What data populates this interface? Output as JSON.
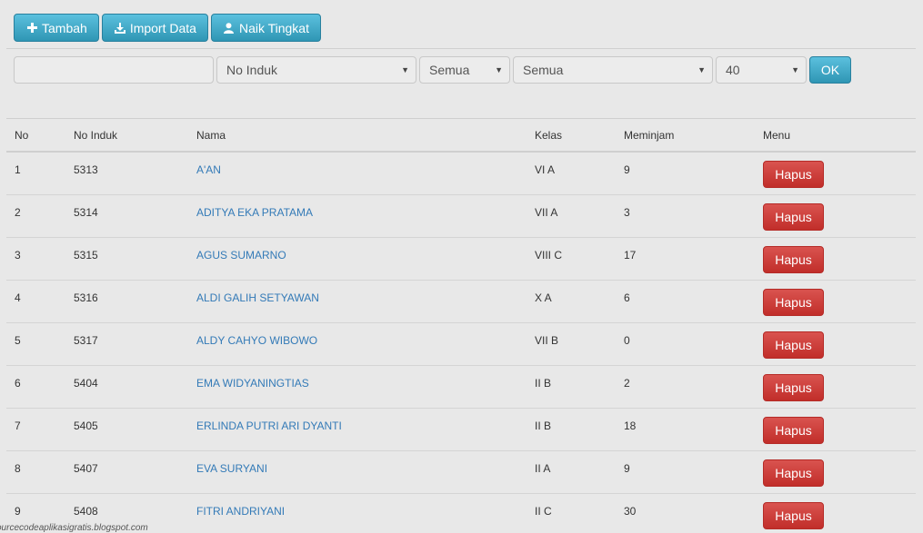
{
  "toolbar": {
    "add_label": "Tambah",
    "import_label": "Import Data",
    "promote_label": "Naik Tingkat"
  },
  "filters": {
    "search_value": "",
    "field_select": "No Induk",
    "kelas_select": "Semua",
    "status_select": "Semua",
    "limit_select": "40",
    "ok_label": "OK"
  },
  "table": {
    "headers": {
      "no": "No",
      "induk": "No Induk",
      "nama": "Nama",
      "kelas": "Kelas",
      "pinjam": "Meminjam",
      "menu": "Menu"
    },
    "delete_label": "Hapus",
    "rows": [
      {
        "no": "1",
        "induk": "5313",
        "nama": "A'AN",
        "kelas": "VI A",
        "pinjam": "9"
      },
      {
        "no": "2",
        "induk": "5314",
        "nama": "ADITYA EKA PRATAMA",
        "kelas": "VII A",
        "pinjam": "3"
      },
      {
        "no": "3",
        "induk": "5315",
        "nama": "AGUS SUMARNO",
        "kelas": "VIII C",
        "pinjam": "17"
      },
      {
        "no": "4",
        "induk": "5316",
        "nama": "ALDI GALIH SETYAWAN",
        "kelas": "X A",
        "pinjam": "6"
      },
      {
        "no": "5",
        "induk": "5317",
        "nama": "ALDY CAHYO WIBOWO",
        "kelas": "VII B",
        "pinjam": "0"
      },
      {
        "no": "6",
        "induk": "5404",
        "nama": "EMA WIDYANINGTIAS",
        "kelas": "II B",
        "pinjam": "2"
      },
      {
        "no": "7",
        "induk": "5405",
        "nama": "ERLINDA PUTRI ARI DYANTI",
        "kelas": "II B",
        "pinjam": "18"
      },
      {
        "no": "8",
        "induk": "5407",
        "nama": "EVA SURYANI",
        "kelas": "II A",
        "pinjam": "9"
      },
      {
        "no": "9",
        "induk": "5408",
        "nama": "FITRI ANDRIYANI",
        "kelas": "II C",
        "pinjam": "30"
      }
    ]
  },
  "watermark": "ourcecodeaplikasigratis.blogspot.com",
  "colors": {
    "info_button": "#5bc0de",
    "danger_button": "#d9534f",
    "link": "#337ab7"
  },
  "icons": {
    "add": "plus-icon",
    "import": "download-icon",
    "promote": "user-icon"
  }
}
